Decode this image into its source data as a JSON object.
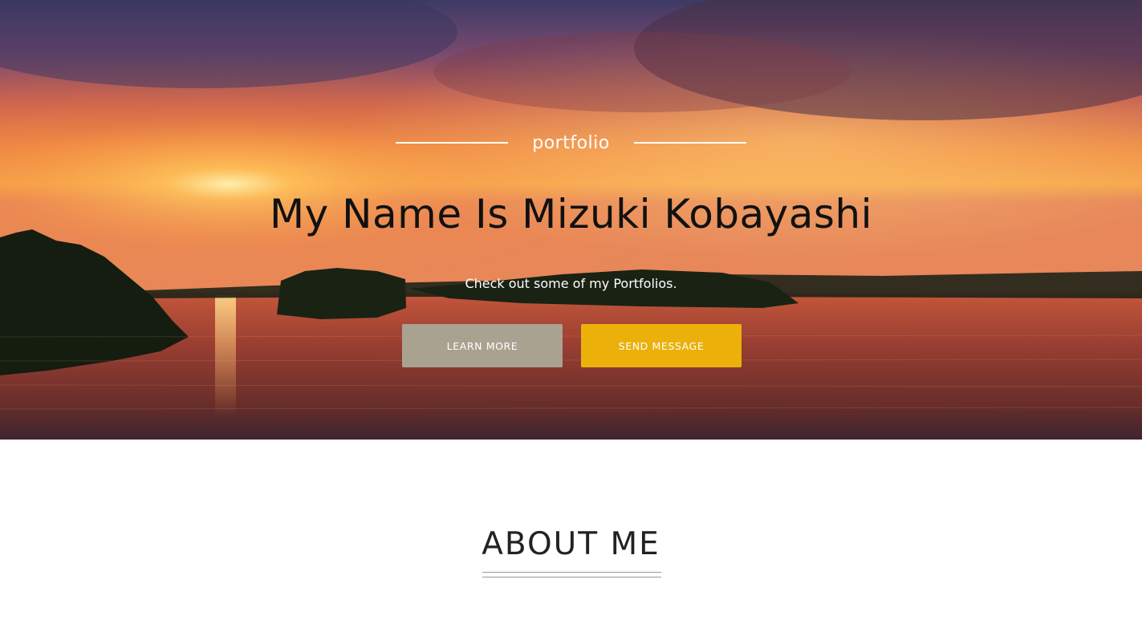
{
  "hero": {
    "tagline": "portfolio",
    "title": "My Name Is Mizuki Kobayashi",
    "subtitle": "Check out some of my Portfolios.",
    "learn_more_label": "LEARN MORE",
    "send_message_label": "SEND MESSAGE"
  },
  "about": {
    "heading": "ABOUT ME"
  },
  "colors": {
    "learn_button": "#aaa291",
    "send_button": "#ebb10a",
    "sky_top": "#3c3a66",
    "sunset_glow": "#f39a3c",
    "water": "#6a2e2a"
  },
  "icons": {
    "background": "sunset-lake-image"
  }
}
